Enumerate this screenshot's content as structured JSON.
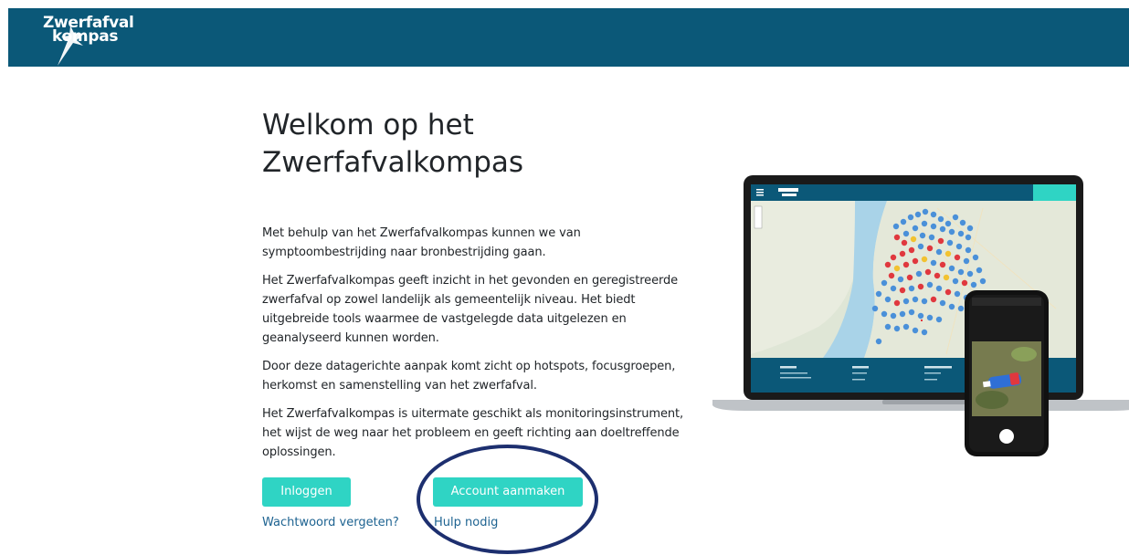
{
  "header": {
    "logo_line1": "Zwerfafval",
    "logo_line2": "kompas",
    "logo_icon": "lightning-star-logo"
  },
  "main": {
    "title": "Welkom op het Zwerfafvalkompas",
    "paragraphs": [
      "Met behulp van het Zwerfafvalkompas kunnen we van symptoombestrijding naar bronbestrijding gaan.",
      "Het Zwerfafvalkompas geeft inzicht in het gevonden en geregistreerde zwerfafval op zowel landelijk als gemeentelijk niveau. Het biedt uitgebreide tools waarmee de vastgelegde data uitgelezen en geanalyseerd kunnen worden.",
      "Door deze datagerichte aanpak komt zicht op hotspots, focusgroepen, herkomst en samenstelling van het zwerfafval.",
      "Het Zwerfafvalkompas is uitermate geschikt als monitoringsinstrument, het wijst de weg naar het probleem en geeft richting aan doeltreffende oplossingen."
    ],
    "login_label": "Inloggen",
    "create_account_label": "Account aanmaken",
    "forgot_password_label": "Wachtwoord vergeten?",
    "help_label": "Hulp nodig"
  },
  "colors": {
    "brand": "#0b5878",
    "button": "#2fd4c4",
    "link": "#1e6391",
    "annotation_circle": "#1d2f6f"
  }
}
